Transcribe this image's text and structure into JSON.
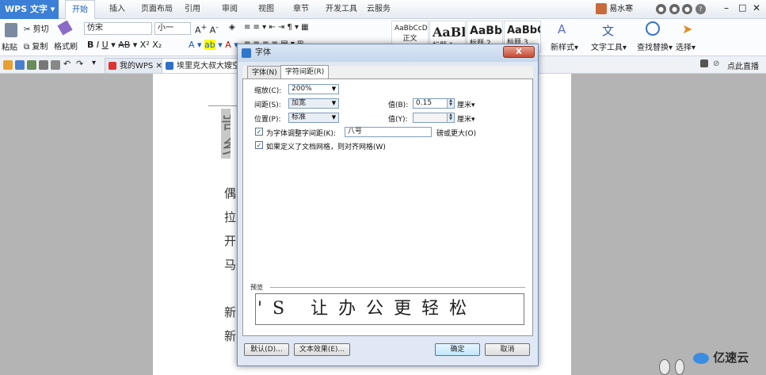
{
  "app": {
    "name": "WPS 文字"
  },
  "menu": {
    "tabs": [
      "开始",
      "插入",
      "页面布局",
      "引用",
      "审阅",
      "视图",
      "章节",
      "开发工具",
      "云服务"
    ],
    "active": "开始"
  },
  "user": {
    "name": "易水寒"
  },
  "ribbon": {
    "paste": "粘贴",
    "cut": "剪切",
    "copy": "复制",
    "format_painter": "格式刷",
    "font_name": "仿宋",
    "font_size": "小一",
    "styles": [
      "AaBbCcDd",
      "AaBl",
      "AaBb(",
      "AaBbC"
    ],
    "style_labels": [
      "正文",
      "标题 1",
      "标题 2",
      "标题 3"
    ],
    "new_style": "新样式",
    "text_tool": "文字工具",
    "find_replace": "查找替换",
    "select": "选择"
  },
  "quickbar": {
    "tabs": [
      "我的WPS",
      "埃里克大叔大嫂空间"
    ],
    "right_label": "点此直播"
  },
  "document": {
    "heading_chars": [
      "岢",
      "乡"
    ],
    "lines": [
      "偶",
      "拉",
      "开",
      "马",
      "新",
      "新"
    ]
  },
  "dialog": {
    "title": "字体",
    "close": "X",
    "tabs": [
      "字体(N)",
      "字符间距(R)"
    ],
    "scale_label": "缩放(C):",
    "scale_value": "200%",
    "spacing_label": "间距(S):",
    "spacing_value": "加宽",
    "spacing_amount_label": "值(B):",
    "spacing_amount": "0.15",
    "spacing_unit": "厘米▾",
    "position_label": "位置(P):",
    "position_value": "标准",
    "position_amount_label": "值(Y):",
    "position_amount": "",
    "position_unit": "厘米▾",
    "kerning_label": "为字体调整字间距(K):",
    "kerning_value": "八号",
    "kerning_suffix": "磅或更大(O)",
    "kerning_checked": true,
    "grid_label": "如果定义了文档网格，则对齐网格(W)",
    "grid_checked": true,
    "preview_label": "预览",
    "preview_text": "'S 让办公更轻松",
    "default_button": "默认(D)...",
    "text_effect_button": "文本效果(E)...",
    "ok_button": "确定",
    "cancel_button": "取消"
  },
  "watermark": "亿速云"
}
